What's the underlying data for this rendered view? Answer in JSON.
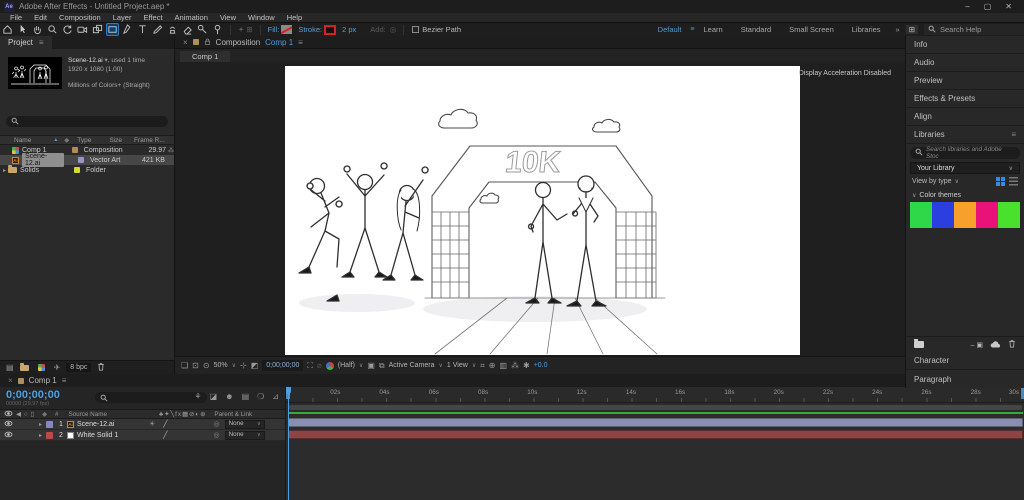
{
  "window": {
    "title": "Adobe After Effects - Untitled Project.aep *",
    "app_icon": "Ae"
  },
  "menu": {
    "items": [
      "File",
      "Edit",
      "Composition",
      "Layer",
      "Effect",
      "Animation",
      "View",
      "Window",
      "Help"
    ]
  },
  "toolbar": {
    "tools": [
      "home",
      "selection",
      "hand",
      "zoom",
      "rotate",
      "camera",
      "pan-behind",
      "rectangle",
      "pen",
      "type",
      "brush",
      "clone-stamp",
      "eraser",
      "roto-brush",
      "puppet-pin"
    ],
    "active_tool": "rectangle",
    "fill_label": "Fill:",
    "stroke_label": "Stroke:",
    "stroke_width": "2 px",
    "add_label": "Add:",
    "bezier_path_label": "Bezier Path",
    "workspaces": [
      "Default",
      "Learn",
      "Standard",
      "Small Screen",
      "Libraries"
    ],
    "active_workspace": "Default",
    "more_workspaces": "»",
    "search_placeholder": "Search Help"
  },
  "project": {
    "tab": "Project",
    "preview": {
      "name": "Scene-12.ai",
      "usage": ", used 1 time",
      "dimensions": "1920 x 1080 (1.00)",
      "color_depth": "Millions of Colors+ (Straight)"
    },
    "columns": {
      "name": "Name",
      "type": "Type",
      "size": "Size",
      "frame_rate": "Frame R..."
    },
    "rows": [
      {
        "name": "Comp 1",
        "type": "Composition",
        "size": "",
        "frame_rate": "29.97"
      },
      {
        "name": "Scene-12.ai",
        "type": "Vector Art",
        "size": "421 KB",
        "frame_rate": ""
      },
      {
        "name": "Solids",
        "type": "Folder",
        "size": "",
        "frame_rate": ""
      }
    ],
    "bit_depth": "8 bpc"
  },
  "composition": {
    "panel_title": "Composition",
    "comp_name": "Comp 1",
    "viewer_tab": "Comp 1",
    "notice": "Display Acceleration Disabled",
    "canvas": {
      "arch_text": "10K"
    },
    "controls": {
      "zoom": "50%",
      "timecode": "0;00;00;00",
      "resolution": "(Half)",
      "camera": "Active Camera",
      "views": "1 View",
      "exposure": "+0.0"
    }
  },
  "right_panels": {
    "collapsed_top": [
      "Info",
      "Audio",
      "Preview",
      "Effects & Presets",
      "Align"
    ],
    "collapsed_bottom": [
      "Character",
      "Paragraph"
    ]
  },
  "libraries": {
    "title": "Libraries",
    "search_placeholder": "Search libraries and Adobe Stoc",
    "library_name": "Your Library",
    "view_by_label": "View by type",
    "section_label": "Color themes",
    "swatches": [
      "#2fd849",
      "#2b3fe0",
      "#f7a12c",
      "#e81279",
      "#4ae02e"
    ]
  },
  "timeline": {
    "tab": "Comp 1",
    "timecode": "0;00;00;00",
    "frame_info": "00000 (29.97 fps)",
    "columns": {
      "source_name": "Source Name",
      "parent_link": "Parent & Link"
    },
    "layers": [
      {
        "number": "1",
        "name": "Scene-12.ai",
        "parent": "None",
        "label_color": "#8388c4",
        "bar_color": "#8a8fb2"
      },
      {
        "number": "2",
        "name": "White Solid 1",
        "parent": "None",
        "label_color": "#c04747",
        "bar_color": "#8e4444"
      }
    ],
    "ruler": [
      "02s",
      "04s",
      "06s",
      "08s",
      "10s",
      "12s",
      "14s",
      "16s",
      "18s",
      "20s",
      "22s",
      "24s",
      "26s",
      "28s",
      "30s"
    ],
    "render_bar_color": "#2fae2f"
  }
}
